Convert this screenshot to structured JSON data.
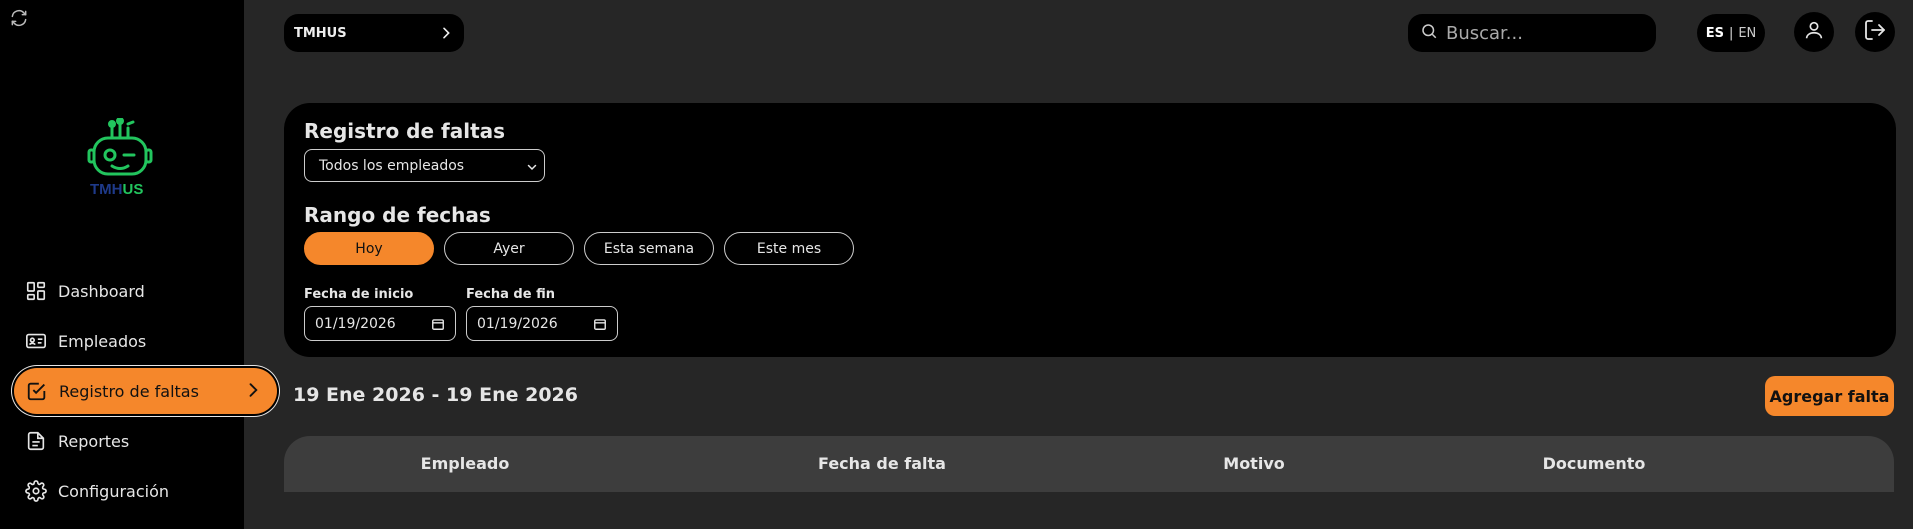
{
  "sidebar": {
    "logo_text_a": "TMH",
    "logo_text_b": "US",
    "items": [
      {
        "label": "Dashboard",
        "icon": "dashboard-icon"
      },
      {
        "label": "Empleados",
        "icon": "id-card-icon"
      },
      {
        "label": "Registro de faltas",
        "icon": "checkbox-icon",
        "active": true
      },
      {
        "label": "Reportes",
        "icon": "document-icon"
      },
      {
        "label": "Configuración",
        "icon": "gear-icon"
      }
    ]
  },
  "header": {
    "company": "TMHUS",
    "search_placeholder": "Buscar...",
    "lang_es": "ES",
    "lang_sep": "|",
    "lang_en": "EN"
  },
  "filters": {
    "title": "Registro de faltas",
    "employee_select": "Todos los empleados",
    "range_title": "Rango de fechas",
    "ranges": [
      "Hoy",
      "Ayer",
      "Esta semana",
      "Este mes"
    ],
    "start_label": "Fecha de inicio",
    "start_value": "01/19/2026",
    "end_label": "Fecha de fin",
    "end_value": "01/19/2026"
  },
  "results": {
    "range_text": "19 Ene 2026 - 19 Ene 2026",
    "add_button": "Agregar falta",
    "columns": [
      "Empleado",
      "Fecha de falta",
      "Motivo",
      "Documento"
    ]
  },
  "colors": {
    "accent": "#f5872b",
    "logo_green": "#22c55e",
    "logo_blue": "#1e3a8a"
  }
}
